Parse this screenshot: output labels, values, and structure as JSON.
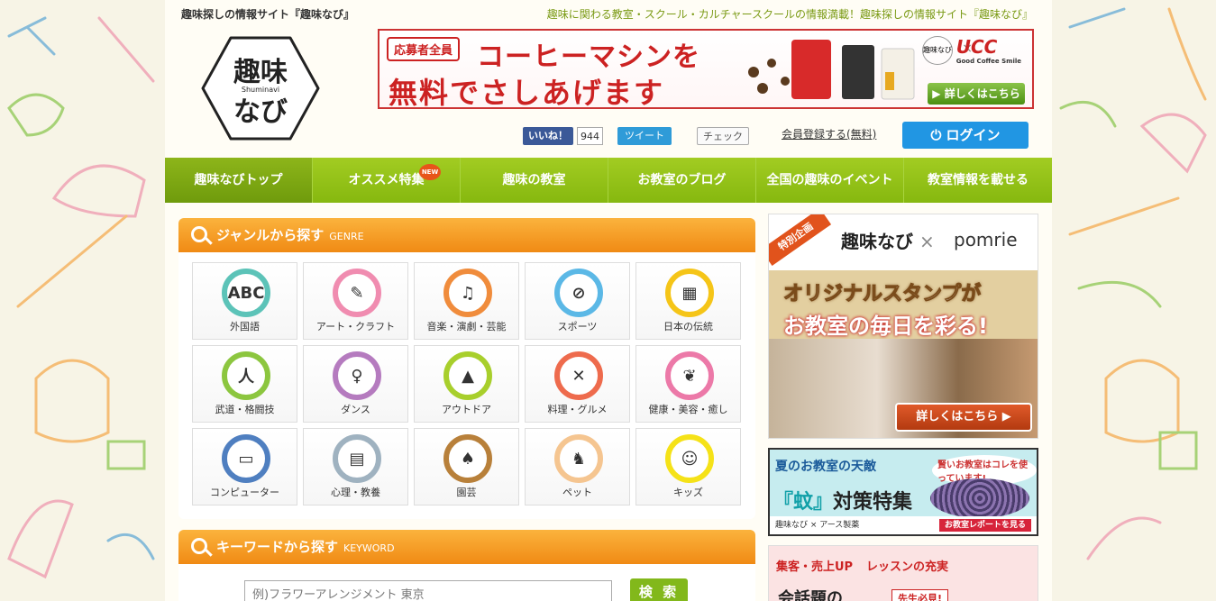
{
  "header": {
    "site_title": "趣味探しの情報サイト『趣味なび』",
    "tagline": "趣味に関わる教室・スクール・カルチャースクールの情報満載！趣味探しの情報サイト『趣味なび』"
  },
  "logo": {
    "line1": "趣味",
    "sub": "Shuminavi",
    "line2": "なび"
  },
  "banner": {
    "badge": "応募者全員",
    "line1": "コーヒーマシンを",
    "line2": "無料でさしあげます",
    "partner_mini": "趣味なび",
    "x": "×",
    "partner": "UCC",
    "partner_sub": "Good Coffee Smile",
    "more": "▶ 詳しくはこちら"
  },
  "social": {
    "fb_label": "いいね！",
    "fb_count": "944",
    "tweet_label": "ツイート",
    "mixi_label": "チェック"
  },
  "account": {
    "register": "会員登録する(無料)",
    "login": "ログイン"
  },
  "nav": {
    "items": [
      {
        "label": "趣味なびトップ"
      },
      {
        "label": "オススメ特集",
        "badge": "NEW"
      },
      {
        "label": "趣味の教室"
      },
      {
        "label": "お教室のブログ"
      },
      {
        "label": "全国の趣味のイベント"
      },
      {
        "label": "教室情報を載せる"
      }
    ]
  },
  "genre": {
    "title": "ジャンルから探す",
    "title_en": "GENRE",
    "items": [
      {
        "label": "外国語",
        "icon": "ABC",
        "color": "#5cc3b8"
      },
      {
        "label": "アート・クラフト",
        "icon": "✎",
        "color": "#f08cb0"
      },
      {
        "label": "音楽・演劇・芸能",
        "icon": "♫",
        "color": "#f08c3c"
      },
      {
        "label": "スポーツ",
        "icon": "⊘",
        "color": "#5bb8e6"
      },
      {
        "label": "日本の伝統",
        "icon": "▦",
        "color": "#f5c518"
      },
      {
        "label": "武道・格闘技",
        "icon": "人",
        "color": "#8cc63f"
      },
      {
        "label": "ダンス",
        "icon": "♀",
        "color": "#b57bbf"
      },
      {
        "label": "アウトドア",
        "icon": "▲",
        "color": "#a8cf2c"
      },
      {
        "label": "料理・グルメ",
        "icon": "✕",
        "color": "#ee6b4d"
      },
      {
        "label": "健康・美容・癒し",
        "icon": "❦",
        "color": "#ec79a8"
      },
      {
        "label": "コンピューター",
        "icon": "▭",
        "color": "#4f7fc0"
      },
      {
        "label": "心理・教養",
        "icon": "▤",
        "color": "#9fb2c0"
      },
      {
        "label": "園芸",
        "icon": "♠",
        "color": "#b8803a"
      },
      {
        "label": "ペット",
        "icon": "♞",
        "color": "#f5c590"
      },
      {
        "label": "キッズ",
        "icon": "☺",
        "color": "#f5e218"
      }
    ]
  },
  "keyword": {
    "title": "キーワードから探す",
    "title_en": "KEYWORD",
    "placeholder": "例)フラワーアレンジメント 東京",
    "button": "検 索"
  },
  "ads": {
    "pomrie": {
      "ribbon": "特別企画",
      "brand": "趣味なび",
      "x": "×",
      "partner": "pomrie",
      "headline1": "オリジナルスタンプが",
      "headline2": "お教室の毎日を彩る!",
      "button": "詳しくはこちら ▶"
    },
    "mosquito": {
      "line1": "夏のお教室の天敵",
      "badge": "賢いお教室はコレを使っています!",
      "line2_accent": "『蚊』",
      "line2": "対策特集",
      "footer": "趣味なび × アース製薬",
      "footer_btn": "お教室レポートを見る"
    },
    "third": {
      "p1": "集客・売上UP",
      "p2": "レッスンの充実",
      "p3": "会話題の",
      "p4": "先生必見!"
    }
  }
}
